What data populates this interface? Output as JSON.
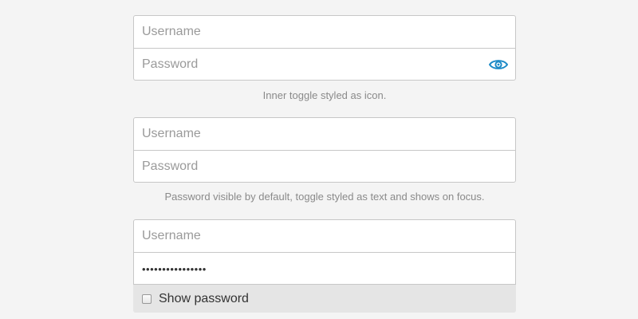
{
  "example1": {
    "username_placeholder": "Username",
    "password_placeholder": "Password",
    "toggle_icon": "eye-icon",
    "caption": "Inner toggle styled as icon."
  },
  "example2": {
    "username_placeholder": "Username",
    "password_placeholder": "Password",
    "caption": "Password visible by default, toggle styled as text and shows on focus."
  },
  "example3": {
    "username_placeholder": "Username",
    "password_value": "••••••••••••••••",
    "show_password_label": "Show password"
  },
  "colors": {
    "accent": "#1c8ac7",
    "background": "#f4f4f4",
    "border": "#c7c7c7",
    "caption_text": "#8a8a8a",
    "toggle_bar": "#e5e5e5"
  }
}
